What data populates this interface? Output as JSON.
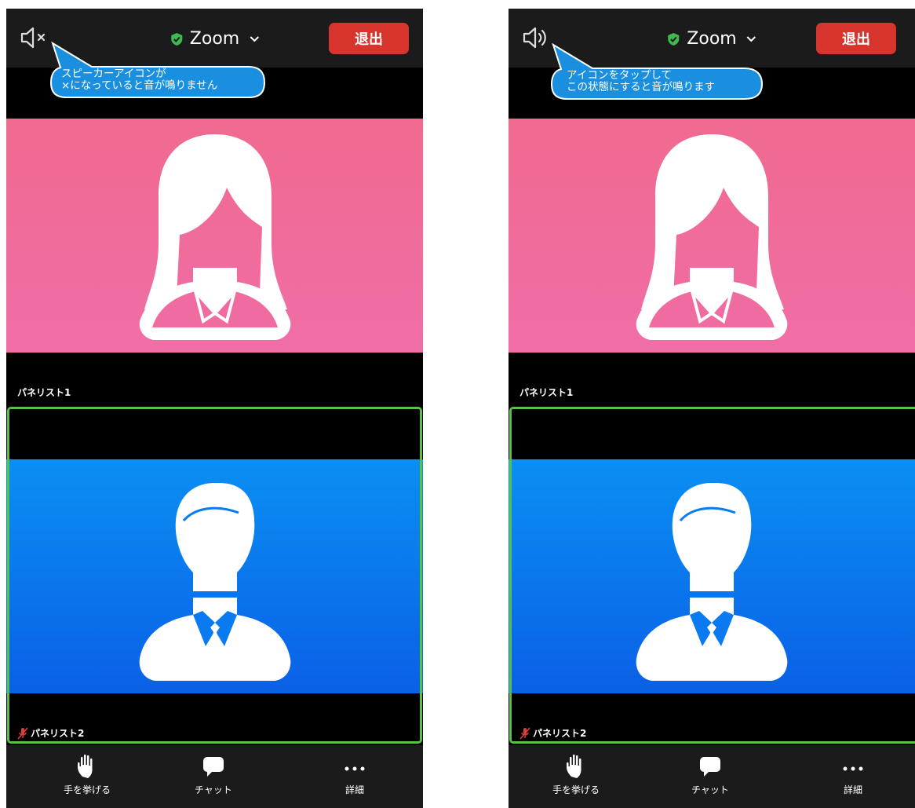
{
  "screens": [
    {
      "speaker_state": "muted",
      "app_title": "Zoom",
      "leave_label": "退出",
      "callout": {
        "line1": "スピーカーアイコンが",
        "line2": "×になっていると音が鳴りません"
      },
      "participants": [
        {
          "name": "パネリスト1",
          "muted": false,
          "bg": "#f06a95"
        },
        {
          "name": "パネリスト2",
          "muted": true,
          "bg": "#0a7ff0",
          "active_speaker": true
        }
      ],
      "toolbar": {
        "raise_hand": "手を挙げる",
        "chat": "チャット",
        "more": "詳細"
      }
    },
    {
      "speaker_state": "on",
      "app_title": "Zoom",
      "leave_label": "退出",
      "callout": {
        "line1": "アイコンをタップして",
        "line2": "この状態にすると音が鳴ります"
      },
      "participants": [
        {
          "name": "パネリスト1",
          "muted": false,
          "bg": "#f06a95"
        },
        {
          "name": "パネリスト2",
          "muted": true,
          "bg": "#0a7ff0",
          "active_speaker": true
        }
      ],
      "toolbar": {
        "raise_hand": "手を挙げる",
        "chat": "チャット",
        "more": "詳細"
      }
    }
  ],
  "colors": {
    "accent_leave": "#d6342c",
    "shield_green": "#3fb950",
    "active_border": "#57c246",
    "callout_blue": "#1a8fe0",
    "mic_muted_red": "#e0393e"
  },
  "icons": [
    "speaker-muted-icon",
    "speaker-on-icon",
    "shield-check-icon",
    "chevron-down-icon",
    "hand-raise-icon",
    "chat-bubble-icon",
    "more-dots-icon",
    "mic-muted-icon"
  ]
}
